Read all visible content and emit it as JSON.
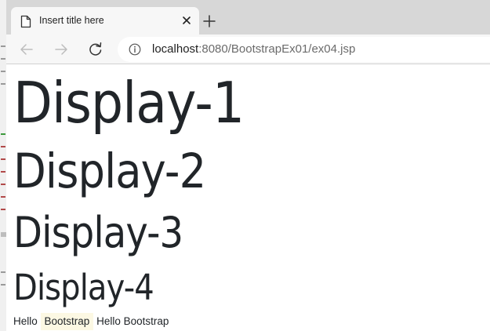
{
  "browser": {
    "tab": {
      "title": "Insert title here",
      "icon": "document-icon",
      "close_icon": "close-icon"
    },
    "new_tab_icon": "plus-icon",
    "toolbar": {
      "back_icon": "arrow-left-icon",
      "forward_icon": "arrow-right-icon",
      "reload_icon": "reload-icon",
      "info_icon": "info-icon",
      "url_host": "localhost",
      "url_rest": ":8080/BootstrapEx01/ex04.jsp"
    }
  },
  "page": {
    "display_1": "Display-1",
    "display_2": "Display-2",
    "display_3": "Display-3",
    "display_4": "Display-4",
    "hello_1": "Hello",
    "hello_mark": "Bootstrap",
    "hello_2": "Hello Bootstrap"
  },
  "colors": {
    "tabstrip": "#d7d7d7",
    "toolbar": "#f7f7f7",
    "text": "#212529",
    "mark_bg": "#fcf8e3"
  }
}
